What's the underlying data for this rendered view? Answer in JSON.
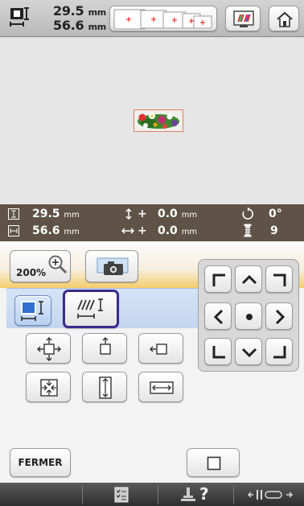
{
  "topbar": {
    "width_value": "29.5",
    "height_value": "56.6",
    "unit": "mm"
  },
  "info": {
    "width_value": "29.5",
    "height_value": "56.6",
    "offset_v_sign": "+",
    "offset_v_value": "0.0",
    "offset_h_sign": "+",
    "offset_h_value": "0.0",
    "unit": "mm",
    "rotation_value": "0°",
    "color_count": "9"
  },
  "toolbar": {
    "zoom_label": "200%"
  },
  "footer": {
    "close_label": "FERMER",
    "help_symbol": "?"
  },
  "colors": {
    "info_bar": "#5e5346",
    "selection_highlight": "#3b2a8a",
    "panel_accent": "#f5cc6c"
  }
}
